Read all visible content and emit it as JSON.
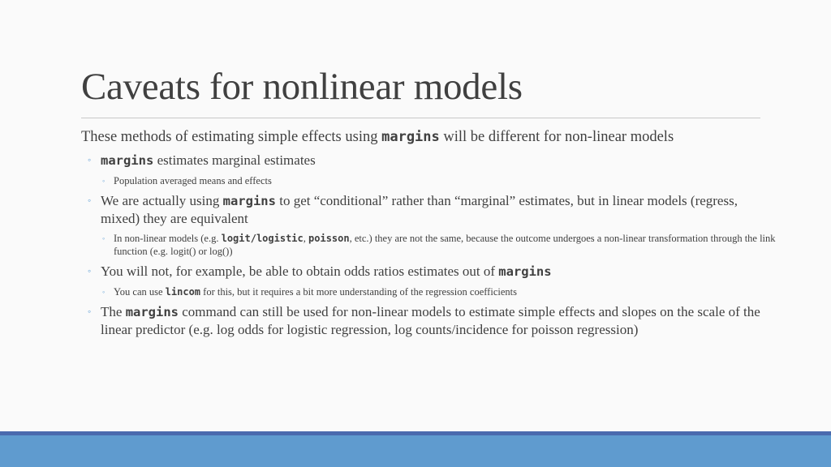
{
  "slide": {
    "title": "Caveats for nonlinear models",
    "bullet_glyph": "◦",
    "intro": {
      "pre": "These methods of estimating simple effects using ",
      "code": "margins",
      "post": " will be different for non-linear models"
    },
    "items": [
      {
        "level": 1,
        "code": "margins",
        "post": " estimates marginal estimates",
        "children": [
          {
            "level": 2,
            "text": "Population averaged means and effects"
          }
        ]
      },
      {
        "level": 1,
        "pre": "We are actually using ",
        "code": "margins",
        "post": " to get “conditional” rather than “marginal” estimates, but in linear models (regress, mixed) they are equivalent",
        "children": [
          {
            "level": 2,
            "pre": "In non-linear models (e.g. ",
            "code1": "logit/logistic",
            "mid": ", ",
            "code2": "poisson",
            "post": ", etc.) they are not the same, because the outcome undergoes a non-linear transformation through the link function (e.g. logit() or log())"
          }
        ]
      },
      {
        "level": 1,
        "pre": "You will not, for example, be able to obtain odds ratios estimates out of ",
        "code": "margins",
        "children": [
          {
            "level": 2,
            "pre": "You can use ",
            "code": "lincom",
            "post": " for this, but it requires a bit more understanding of the regression coefficients"
          }
        ]
      },
      {
        "level": 1,
        "pre": "The ",
        "code": "margins",
        "post": " command can still be used for non-linear models to estimate simple effects and slopes on the scale of the linear predictor (e.g. log odds for logistic regression, log counts/incidence for poisson regression)"
      }
    ]
  },
  "theme": {
    "accent_dark": "#4a6aae",
    "accent_light": "#5f9bcf",
    "bullet_color": "#5a9bd4"
  }
}
